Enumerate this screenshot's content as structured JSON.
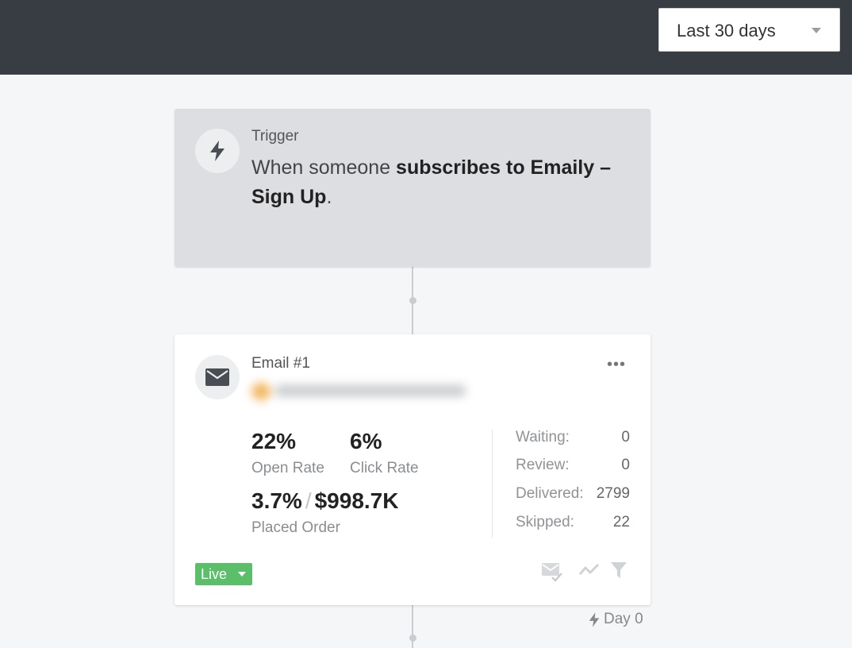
{
  "header": {
    "date_range": "Last 30 days"
  },
  "trigger": {
    "title": "Trigger",
    "text_prefix": "When someone ",
    "text_bold": "subscribes to Emaily – Sign Up",
    "text_suffix": ".",
    "icon": "lightning-bolt-icon"
  },
  "email": {
    "title": "Email #1",
    "icon": "envelope-icon",
    "more": "•••",
    "open_rate": {
      "value": "22%",
      "label": "Open Rate"
    },
    "click_rate": {
      "value": "6%",
      "label": "Click Rate"
    },
    "placed_order": {
      "percent": "3.7%",
      "separator": "/",
      "revenue": "$998.7K",
      "label": "Placed Order"
    },
    "stats": [
      {
        "label": "Waiting:",
        "value": "0"
      },
      {
        "label": "Review:",
        "value": "0"
      },
      {
        "label": "Delivered:",
        "value": "2799"
      },
      {
        "label": "Skipped:",
        "value": "22"
      }
    ],
    "status": "Live",
    "status_color": "#5bbf6a",
    "toolbar_icons": [
      "email-check-icon",
      "trend-icon",
      "filter-icon"
    ]
  },
  "delay": {
    "label": "Day 0",
    "icon": "lightning-bolt-icon"
  }
}
